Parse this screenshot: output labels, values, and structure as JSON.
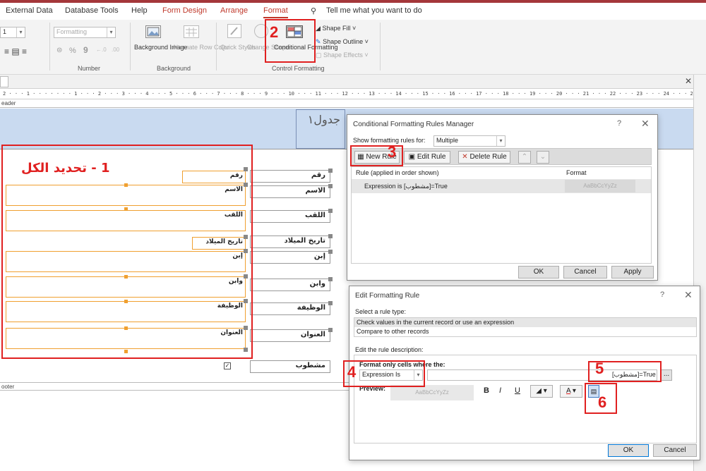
{
  "ribbon_tabs": [
    "External Data",
    "Database Tools",
    "Help",
    "Form Design",
    "Arrange",
    "Format"
  ],
  "tell_me": "Tell me what you want to do",
  "ribbon": {
    "formatting_combo": "Formatting",
    "number_label": "Number",
    "background_image": "Background Image",
    "alternate_row_color": "Alternate Row Color",
    "background_label": "Background",
    "quick_styles": "Quick Styles",
    "change_shape": "Change Shape",
    "conditional_formatting": "Conditional Formatting",
    "shape_fill": "Shape Fill",
    "shape_outline": "Shape Outline",
    "shape_effects": "Shape Effects",
    "control_formatting_label": "Control Formatting",
    "num_percent": "%",
    "num_comma": "9"
  },
  "ruler_text": "2 · · · 1 · · · · · · · 1 · · · 2 · · · 3 · · · 4 · · · 5 · · · 6 · · · 7 · · · 8 · · · 9 · · · 10 · · · 11 · · · 12 · · · 13 · · · 14 · · · 15 · · · 16 · · · 17 · · · 18 · · · 19 · · · 20 · · · 21 · · · 22 · · · 23 · · · 24 · · · 25 · · · 26 · · · 27 · · · 28 · · · 29 · · · 30 · · · 31 · · · 32 · · · 33 · · ·",
  "form": {
    "header_section": "eader",
    "footer_section": "ooter",
    "title": "جدول١",
    "labels": [
      "رقم",
      "الاسم",
      "اللقب",
      "تاريخ الميلاد",
      "إبن",
      "وابن",
      "الوظيفة",
      "العنوان",
      "مشطوب"
    ],
    "fields": [
      "رقم",
      "الاسم",
      "اللقب",
      "تاريخ الميلاد",
      "إبن",
      "وابن",
      "الوظيفة",
      "العنوان"
    ]
  },
  "annotations": {
    "step1": "1 - تحديد الكل",
    "n2": "2",
    "n3": "3",
    "n4": "4",
    "n5": "5",
    "n6": "6"
  },
  "rules_manager": {
    "title": "Conditional Formatting Rules Manager",
    "show_rules_for_label": "Show formatting rules for:",
    "show_rules_for_value": "Multiple",
    "new_rule": "New Rule",
    "edit_rule": "Edit Rule",
    "delete_rule": "Delete Rule",
    "col_rule": "Rule (applied in order shown)",
    "col_format": "Format",
    "rule_text": "Expression is [مشطوب]=True",
    "format_preview": "AaBbCcYyZz",
    "ok": "OK",
    "cancel": "Cancel",
    "apply": "Apply"
  },
  "edit_rule": {
    "title": "Edit Formatting Rule",
    "select_type_label": "Select a rule type:",
    "rule_types": [
      "Check values in the current record or use an expression",
      "Compare to other records"
    ],
    "edit_desc_label": "Edit the rule description:",
    "format_only_label": "Format only cells where the:",
    "condition": "Expression Is",
    "expression": "[مشطوب]=True",
    "preview_label": "Preview:",
    "preview_text": "AaBbCcYyZz",
    "bold": "B",
    "italic": "I",
    "underline": "U",
    "ok": "OK",
    "cancel": "Cancel",
    "ellipsis": "..."
  },
  "colors": {
    "accent": "#c0392b",
    "annotation": "#e02020",
    "header_band": "#c9daf0",
    "field_border": "#f0a030"
  }
}
